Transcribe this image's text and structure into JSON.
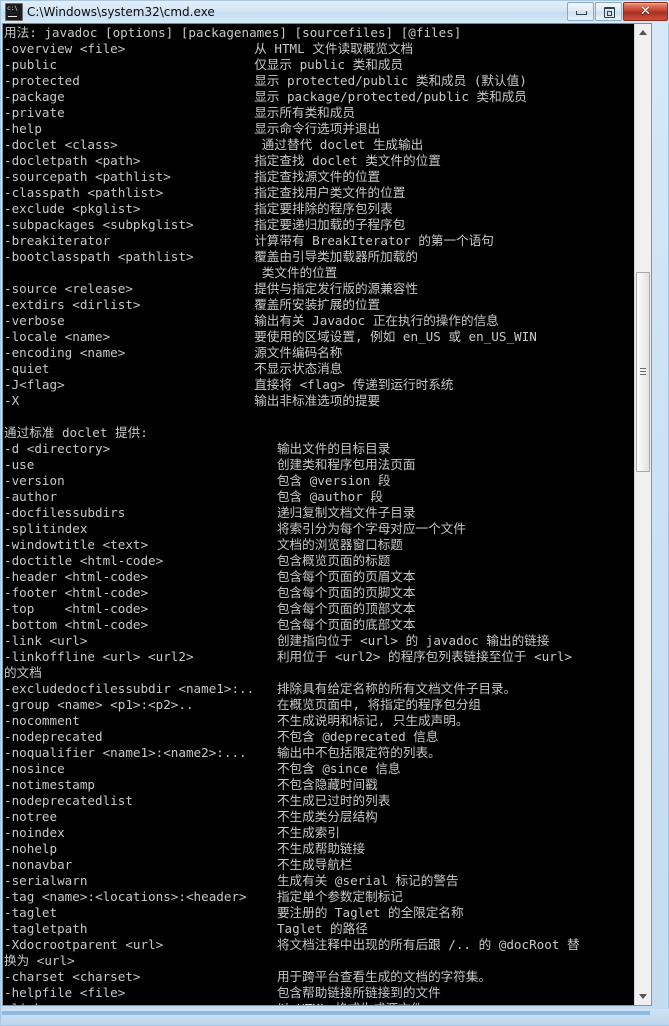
{
  "window": {
    "title": "C:\\Windows\\system32\\cmd.exe",
    "ghost_title": "                                          ",
    "buttons": {
      "minimize": "minimize",
      "maximize": "maximize",
      "close": "✕"
    }
  },
  "console": {
    "text": "用法: javadoc [options] [packagenames] [sourcefiles] [@files]\n-overview <file>                 从 HTML 文件读取概览文档\n-public                          仅显示 public 类和成员\n-protected                       显示 protected/public 类和成员 (默认值)\n-package                         显示 package/protected/public 类和成员\n-private                         显示所有类和成员\n-help                            显示命令行选项并退出\n-doclet <class>                   通过替代 doclet 生成输出\n-docletpath <path>               指定查找 doclet 类文件的位置\n-sourcepath <pathlist>           指定查找源文件的位置\n-classpath <pathlist>            指定查找用户类文件的位置\n-exclude <pkglist>               指定要排除的程序包列表\n-subpackages <subpkglist>        指定要递归加载的子程序包\n-breakiterator                   计算带有 BreakIterator 的第一个语句\n-bootclasspath <pathlist>        覆盖由引导类加载器所加载的\n                                  类文件的位置\n-source <release>                提供与指定发行版的源兼容性\n-extdirs <dirlist>               覆盖所安装扩展的位置\n-verbose                         输出有关 Javadoc 正在执行的操作的信息\n-locale <name>                   要使用的区域设置, 例如 en_US 或 en_US_WIN\n-encoding <name>                 源文件编码名称\n-quiet                           不显示状态消息\n-J<flag>                         直接将 <flag> 传递到运行时系统\n-X                               输出非标准选项的提要\n\n通过标准 doclet 提供:\n-d <directory>                      输出文件的目标目录\n-use                                创建类和程序包用法页面\n-version                            包含 @version 段\n-author                             包含 @author 段\n-docfilessubdirs                    递归复制文档文件子目录\n-splitindex                         将索引分为每个字母对应一个文件\n-windowtitle <text>                 文档的浏览器窗口标题\n-doctitle <html-code>               包含概览页面的标题\n-header <html-code>                 包含每个页面的页眉文本\n-footer <html-code>                 包含每个页面的页脚文本\n-top    <html-code>                 包含每个页面的顶部文本\n-bottom <html-code>                 包含每个页面的底部文本\n-link <url>                         创建指向位于 <url> 的 javadoc 输出的链接\n-linkoffline <url> <url2>           利用位于 <url2> 的程序包列表链接至位于 <url>\n的文档\n-excludedocfilessubdir <name1>:..   排除具有给定名称的所有文档文件子目录。\n-group <name> <p1>:<p2>..           在概览页面中, 将指定的程序包分组\n-nocomment                          不生成说明和标记, 只生成声明。\n-nodeprecated                       不包含 @deprecated 信息\n-noqualifier <name1>:<name2>:...    输出中不包括限定符的列表。\n-nosince                            不包含 @since 信息\n-notimestamp                        不包含隐藏时间戳\n-nodeprecatedlist                   不生成已过时的列表\n-notree                             不生成类分层结构\n-noindex                            不生成索引\n-nohelp                             不生成帮助链接\n-nonavbar                           不生成导航栏\n-serialwarn                         生成有关 @serial 标记的警告\n-tag <name>:<locations>:<header>    指定单个参数定制标记\n-taglet                             要注册的 Taglet 的全限定名称\n-tagletpath                         Taglet 的路径\n-Xdocrootparent <url>               将文档注释中出现的所有后跟 /.. 的 @docRoot 替\n换为 <url>\n-charset <charset>                  用于跨平台查看生成的文档的字符集。\n-helpfile <file>                    包含帮助链接所链接到的文件\n-linksource                         以 HTML 格式生成源文件"
  },
  "scrollbar": {
    "up_arrow": "▲",
    "down_arrow": "▼"
  }
}
